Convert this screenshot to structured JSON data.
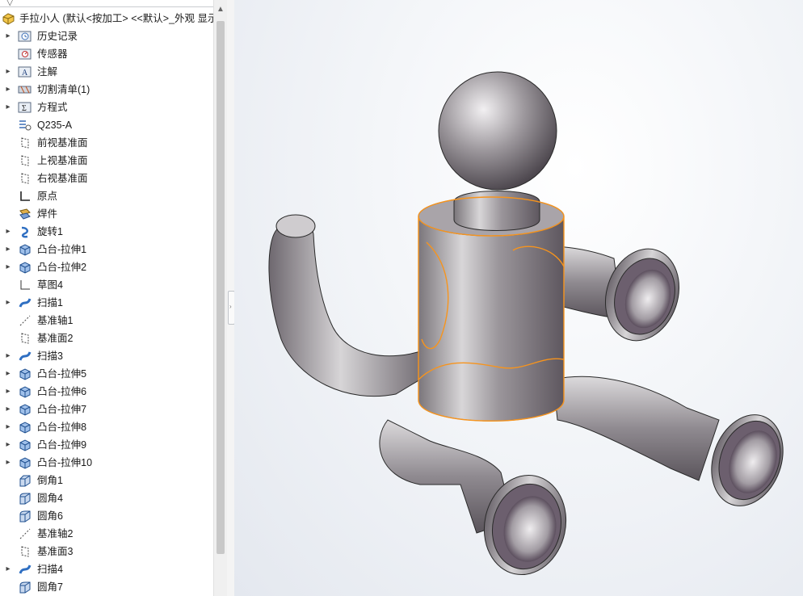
{
  "feature_tree": {
    "root": {
      "label": "手拉小人 (默认<按加工> <<默认>_外观 显示",
      "icon": "part-icon"
    },
    "items": [
      {
        "label": "历史记录",
        "icon": "history-folder-icon",
        "expandable": true
      },
      {
        "label": "传感器",
        "icon": "sensor-folder-icon",
        "expandable": false
      },
      {
        "label": "注解",
        "icon": "annotation-icon",
        "expandable": true
      },
      {
        "label": "切割清单(1)",
        "icon": "cut-list-icon",
        "expandable": true
      },
      {
        "label": "方程式",
        "icon": "equation-icon",
        "expandable": true
      },
      {
        "label": "Q235-A",
        "icon": "material-icon",
        "expandable": false
      },
      {
        "label": "前视基准面",
        "icon": "plane-icon",
        "expandable": false
      },
      {
        "label": "上视基准面",
        "icon": "plane-icon",
        "expandable": false
      },
      {
        "label": "右视基准面",
        "icon": "plane-icon",
        "expandable": false
      },
      {
        "label": "原点",
        "icon": "origin-icon",
        "expandable": false
      },
      {
        "label": "焊件",
        "icon": "weldment-icon",
        "expandable": false
      },
      {
        "label": "旋转1",
        "icon": "revolve-icon",
        "expandable": true
      },
      {
        "label": "凸台-拉伸1",
        "icon": "extrude-icon",
        "expandable": true
      },
      {
        "label": "凸台-拉伸2",
        "icon": "extrude-icon",
        "expandable": true
      },
      {
        "label": "草图4",
        "icon": "sketch-icon",
        "expandable": false
      },
      {
        "label": "扫描1",
        "icon": "sweep-icon",
        "expandable": true
      },
      {
        "label": "基准轴1",
        "icon": "axis-icon",
        "expandable": false
      },
      {
        "label": "基准面2",
        "icon": "plane-icon",
        "expandable": false
      },
      {
        "label": "扫描3",
        "icon": "sweep-icon",
        "expandable": true
      },
      {
        "label": "凸台-拉伸5",
        "icon": "extrude-icon",
        "expandable": true
      },
      {
        "label": "凸台-拉伸6",
        "icon": "extrude-icon",
        "expandable": true
      },
      {
        "label": "凸台-拉伸7",
        "icon": "extrude-icon",
        "expandable": true
      },
      {
        "label": "凸台-拉伸8",
        "icon": "extrude-icon",
        "expandable": true
      },
      {
        "label": "凸台-拉伸9",
        "icon": "extrude-icon",
        "expandable": true
      },
      {
        "label": "凸台-拉伸10",
        "icon": "extrude-icon",
        "expandable": true
      },
      {
        "label": "倒角1",
        "icon": "chamfer-icon",
        "expandable": false
      },
      {
        "label": "圆角4",
        "icon": "fillet-icon",
        "expandable": false
      },
      {
        "label": "圆角6",
        "icon": "fillet-icon",
        "expandable": false
      },
      {
        "label": "基准轴2",
        "icon": "axis-icon",
        "expandable": false
      },
      {
        "label": "基准面3",
        "icon": "plane-icon",
        "expandable": false
      },
      {
        "label": "扫描4",
        "icon": "sweep-icon",
        "expandable": true
      },
      {
        "label": "圆角7",
        "icon": "fillet-icon",
        "expandable": false
      }
    ]
  },
  "viewport": {
    "model": "3d-sitting-figure-model",
    "colors": {
      "metal": "#8e8a8e",
      "metal_light": "#d6d4d6",
      "hole_inner": "#6a5e6c",
      "selection": "#f7941d"
    }
  }
}
